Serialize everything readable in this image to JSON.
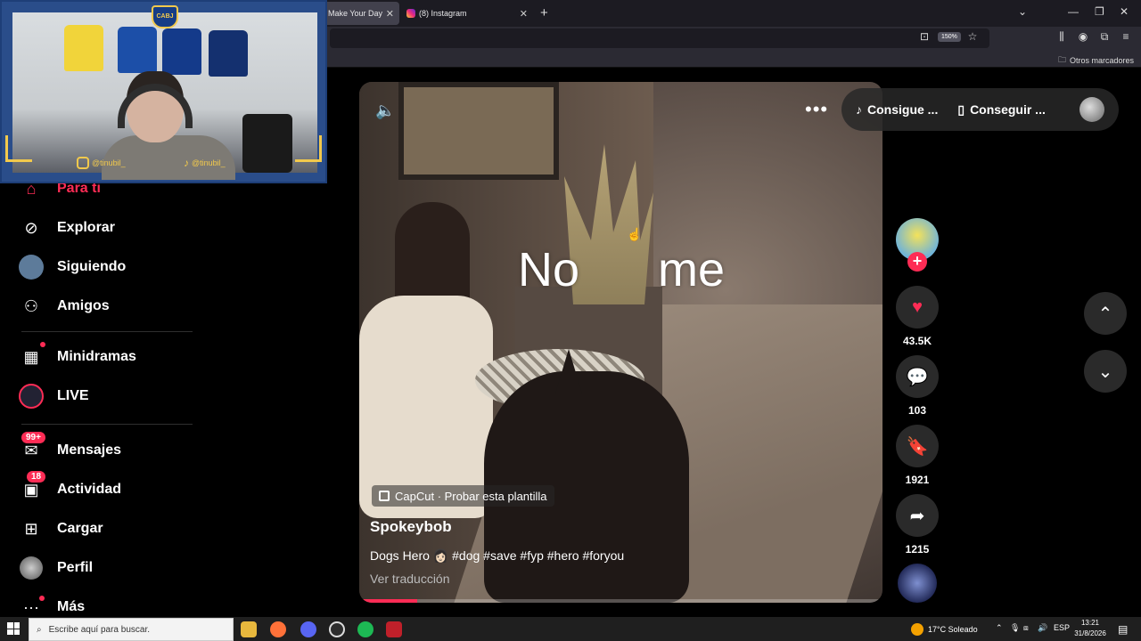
{
  "browser": {
    "tabs": [
      {
        "title": "Make Your Day",
        "active": true
      },
      {
        "title": "(8) Instagram",
        "active": false
      }
    ],
    "zoom": "150%",
    "bookmarks_label": "Otros marcadores"
  },
  "webcam": {
    "instagram_handle": "@tinubil_",
    "tiktok_handle": "@tinubil_",
    "shirt_crest": "CABJ"
  },
  "sidebar": {
    "items": [
      {
        "label": "Para ti",
        "icon": "home-icon",
        "active": true
      },
      {
        "label": "Explorar",
        "icon": "compass-icon"
      },
      {
        "label": "Siguiendo",
        "icon": "following-avatar-icon"
      },
      {
        "label": "Amigos",
        "icon": "friends-icon"
      },
      {
        "label": "Minidramas",
        "icon": "film-icon"
      },
      {
        "label": "LIVE",
        "icon": "live-icon"
      },
      {
        "label": "Mensajes",
        "icon": "messages-icon",
        "badge": "99+"
      },
      {
        "label": "Actividad",
        "icon": "activity-icon",
        "badge": "18"
      },
      {
        "label": "Cargar",
        "icon": "upload-icon"
      },
      {
        "label": "Perfil",
        "icon": "profile-avatar-icon"
      },
      {
        "label": "Más",
        "icon": "more-dots-icon"
      }
    ]
  },
  "video": {
    "overlay_text_left": "No",
    "overlay_text_right": "me",
    "capcut_label": "CapCut · Probar esta plantilla",
    "author": "Spokeybob",
    "description": "Dogs Hero 👩🏻 #dog #save #fyp #hero #foryou",
    "translate_label": "Ver traducción",
    "progress": 0.11
  },
  "top_actions": {
    "get_app_label": "Consigue ...",
    "get_device_label": "Conseguir ..."
  },
  "actions": {
    "likes": "43.5K",
    "comments": "103",
    "saves": "1921",
    "shares": "1215"
  },
  "taskbar": {
    "search_placeholder": "Escribe aquí para buscar.",
    "weather": "17°C  Soleado",
    "language": "ESP",
    "time": "13:21",
    "date": "31/8/2026"
  },
  "colors": {
    "accent": "#fe2c55",
    "background": "#000000"
  }
}
